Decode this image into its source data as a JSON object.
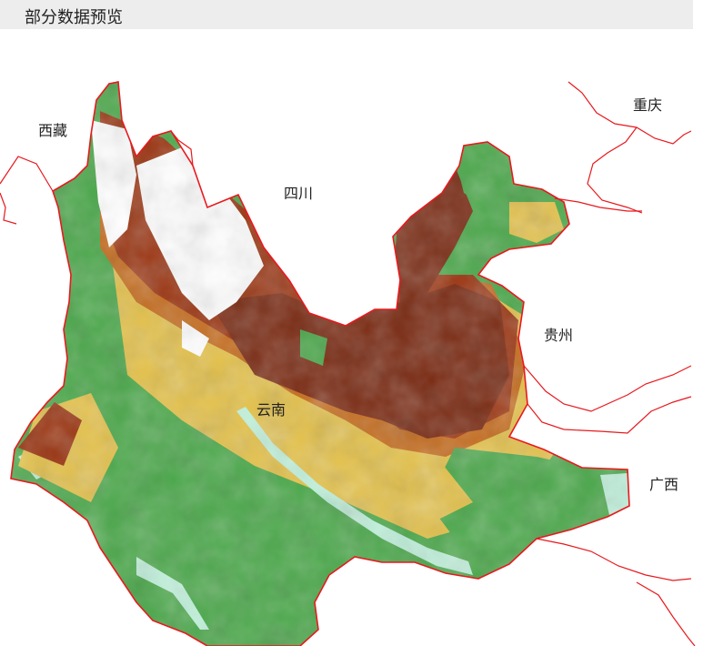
{
  "header": {
    "title": "部分数据预览"
  },
  "map": {
    "labels": {
      "xizang": "西藏",
      "sichuan": "四川",
      "chongqing": "重庆",
      "guizhou": "贵州",
      "yunnan": "云南",
      "guangxi": "广西"
    },
    "colors": {
      "border": "#e8191e",
      "high_elevation": "#ffffff",
      "upper": "#7a2a12",
      "mid_upper": "#9b3512",
      "mid": "#c56a1a",
      "lower": "#e4c14a",
      "low": "#4aa84a",
      "lowest": "#bff0da"
    }
  }
}
